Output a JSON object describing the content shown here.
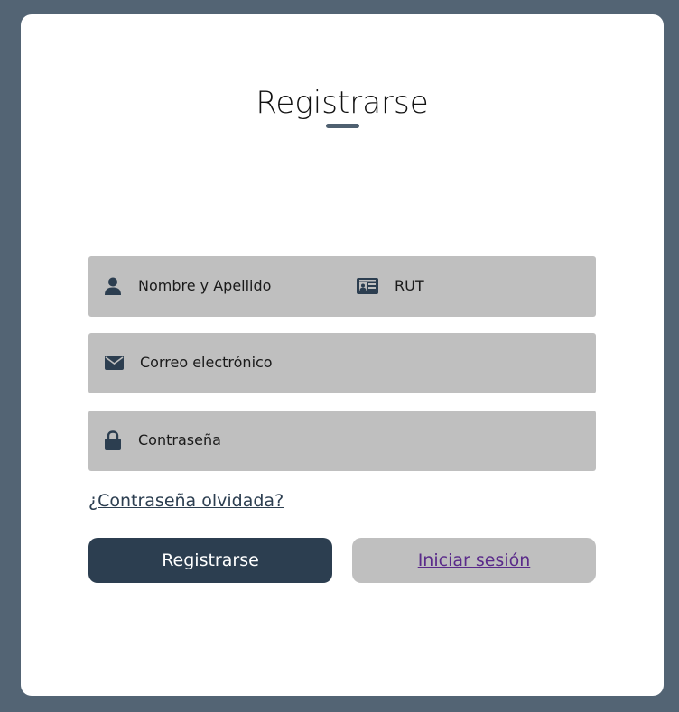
{
  "form": {
    "title": "Registrarse",
    "fields": {
      "name": {
        "placeholder": "Nombre y Apellido",
        "icon": "user-icon"
      },
      "rut": {
        "placeholder": "RUT",
        "icon": "id-card-icon"
      },
      "email": {
        "placeholder": "Correo electrónico",
        "icon": "envelope-icon"
      },
      "password": {
        "placeholder": "Contraseña",
        "icon": "lock-icon"
      }
    },
    "forgot_password_label": "¿Contraseña olvidada?",
    "register_button_label": "Registrarse",
    "login_link_label": "Iniciar sesión"
  },
  "colors": {
    "background": "#536474",
    "card": "#ffffff",
    "field": "#bfbfbf",
    "primary": "#2c3e50",
    "link_visited": "#5a2a8a"
  }
}
